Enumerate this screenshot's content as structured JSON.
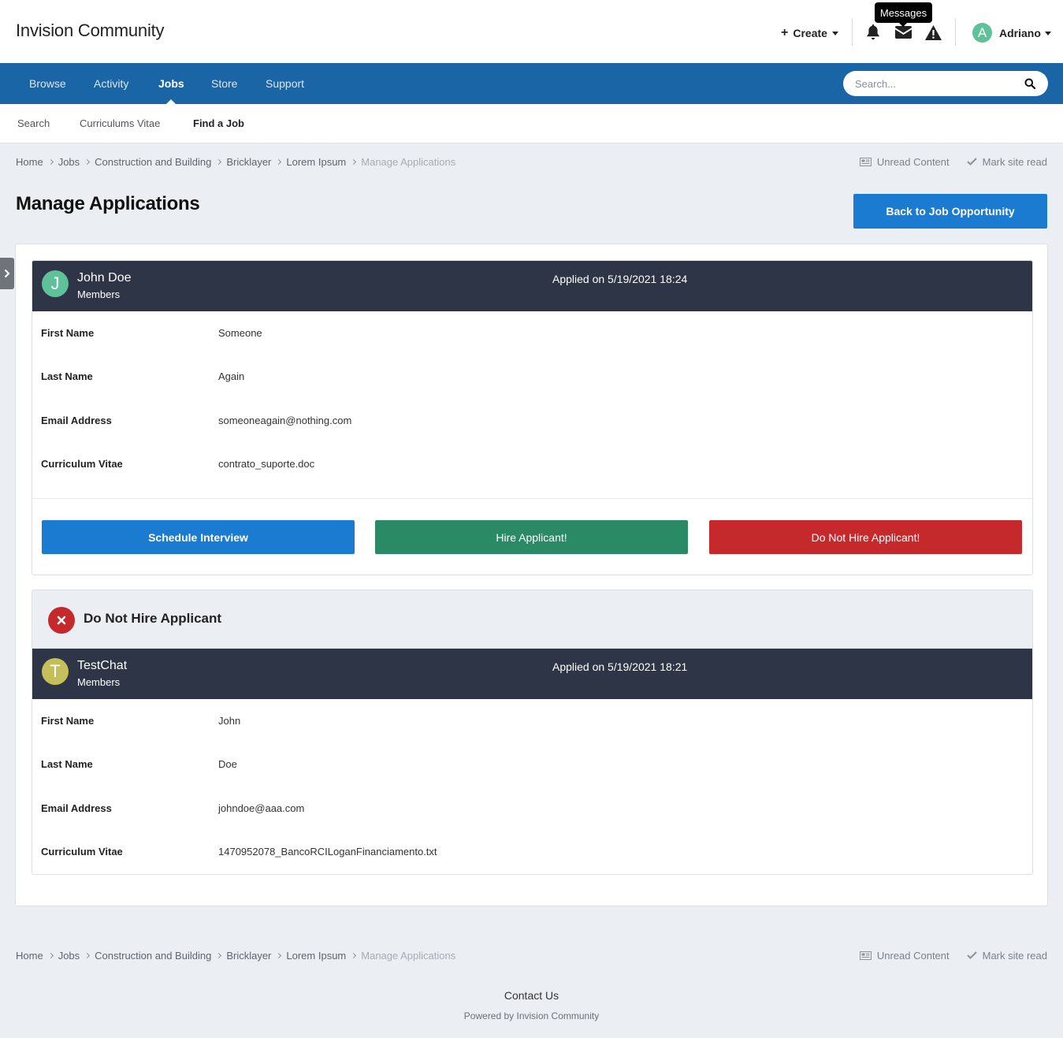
{
  "header": {
    "site_title": "Invision Community",
    "create_label": "Create",
    "tooltip": "Messages",
    "user": {
      "initial": "A",
      "name": "Adriano"
    }
  },
  "nav": {
    "items": [
      {
        "label": "Browse"
      },
      {
        "label": "Activity"
      },
      {
        "label": "Jobs",
        "active": true
      },
      {
        "label": "Store"
      },
      {
        "label": "Support"
      }
    ],
    "search_placeholder": "Search..."
  },
  "subnav": {
    "items": [
      {
        "label": "Search"
      },
      {
        "label": "Curriculums Vitae"
      },
      {
        "label": "Find a Job",
        "active": true
      }
    ]
  },
  "breadcrumb": {
    "items": [
      "Home",
      "Jobs",
      "Construction and Building",
      "Bricklayer",
      "Lorem Ipsum",
      "Manage Applications"
    ],
    "unread": "Unread Content",
    "mark_read": "Mark site read"
  },
  "page": {
    "title": "Manage Applications",
    "back_button": "Back to Job Opportunity"
  },
  "applications": [
    {
      "initial": "J",
      "avatar_color": "#5ec199",
      "name": "John Doe",
      "group": "Members",
      "applied": "Applied on 5/19/2021 18:24",
      "fields": [
        {
          "label": "First Name",
          "value": "Someone"
        },
        {
          "label": "Last Name",
          "value": "Again"
        },
        {
          "label": "Email Address",
          "value": "someoneagain@nothing.com"
        },
        {
          "label": "Curriculum Vitae",
          "value": "contrato_suporte.doc"
        }
      ],
      "actions": {
        "schedule": "Schedule Interview",
        "hire": "Hire Applicant!",
        "reject": "Do Not Hire Applicant!"
      }
    },
    {
      "status": "Do Not Hire Applicant",
      "initial": "T",
      "avatar_color": "#c5bf5a",
      "name": "TestChat",
      "group": "Members",
      "applied": "Applied on 5/19/2021 18:21",
      "fields": [
        {
          "label": "First Name",
          "value": "John"
        },
        {
          "label": "Last Name",
          "value": "Doe"
        },
        {
          "label": "Email Address",
          "value": "johndoe@aaa.com"
        },
        {
          "label": "Curriculum Vitae",
          "value": "1470952078_BancoRCILoganFinanciamento.txt"
        }
      ]
    }
  ],
  "colors": {
    "nav_bg": "#1a65a5",
    "primary": "#1a7bd0",
    "success": "#2b8a66",
    "danger": "#c5292c",
    "card_header": "#2e3546"
  },
  "footer": {
    "contact": "Contact Us",
    "powered": "Powered by Invision Community"
  }
}
